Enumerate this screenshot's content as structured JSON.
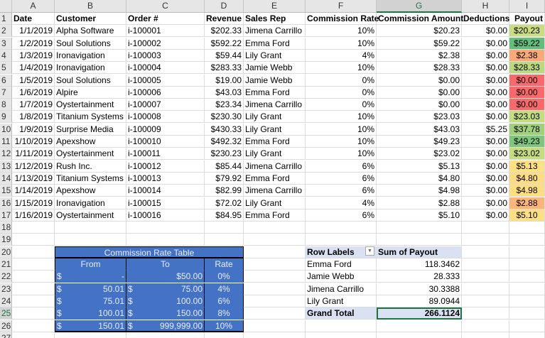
{
  "columns": [
    "A",
    "B",
    "C",
    "D",
    "E",
    "F",
    "G",
    "H",
    "I"
  ],
  "selected_column": "G",
  "selected_row": 25,
  "headers": [
    "Date",
    "Customer",
    "Order #",
    "Revenue",
    "Sales Rep",
    "Commission Rate",
    "Commission Amount",
    "Deductions",
    "Payout"
  ],
  "rows": [
    [
      "1/1/2019",
      "Alpha Software",
      "i-100001",
      "$202.33",
      "Jimena Carrillo",
      "10%",
      "$20.23",
      "$0.00",
      "$20.23"
    ],
    [
      "1/2/2019",
      "Soul Solutions",
      "i-100002",
      "$592.22",
      "Emma Ford",
      "10%",
      "$59.22",
      "$0.00",
      "$59.22"
    ],
    [
      "1/3/2019",
      "Ironavigation",
      "i-100003",
      "$59.44",
      "Lily Grant",
      "4%",
      "$2.38",
      "$0.00",
      "$2.38"
    ],
    [
      "1/4/2019",
      "Ironavigation",
      "i-100004",
      "$283.33",
      "Jamie Webb",
      "10%",
      "$28.33",
      "$0.00",
      "$28.33"
    ],
    [
      "1/5/2019",
      "Soul Solutions",
      "i-100005",
      "$19.00",
      "Jamie Webb",
      "0%",
      "$0.00",
      "$0.00",
      "$0.00"
    ],
    [
      "1/6/2019",
      "Alpire",
      "i-100006",
      "$43.03",
      "Emma Ford",
      "0%",
      "$0.00",
      "$0.00",
      "$0.00"
    ],
    [
      "1/7/2019",
      "Oystertainment",
      "i-100007",
      "$23.34",
      "Jimena Carrillo",
      "0%",
      "$0.00",
      "$0.00",
      "$0.00"
    ],
    [
      "1/8/2019",
      "Titanium Systems",
      "i-100008",
      "$230.30",
      "Lily Grant",
      "10%",
      "$23.03",
      "$0.00",
      "$23.03"
    ],
    [
      "1/9/2019",
      "Surprise Media",
      "i-100009",
      "$430.33",
      "Lily Grant",
      "10%",
      "$43.03",
      "$5.25",
      "$37.78"
    ],
    [
      "1/10/2019",
      "Apexshow",
      "i-100010",
      "$492.32",
      "Emma Ford",
      "10%",
      "$49.23",
      "$0.00",
      "$49.23"
    ],
    [
      "1/11/2019",
      "Oystertainment",
      "i-100011",
      "$230.23",
      "Lily Grant",
      "10%",
      "$23.02",
      "$0.00",
      "$23.02"
    ],
    [
      "1/12/2019",
      "Rush Inc.",
      "i-100012",
      "$85.44",
      "Jimena Carrillo",
      "6%",
      "$5.13",
      "$0.00",
      "$5.13"
    ],
    [
      "1/13/2019",
      "Titanium Systems",
      "i-100013",
      "$79.92",
      "Emma Ford",
      "6%",
      "$4.80",
      "$0.00",
      "$4.80"
    ],
    [
      "1/14/2019",
      "Apexshow",
      "i-100014",
      "$82.99",
      "Jimena Carrillo",
      "6%",
      "$4.98",
      "$0.00",
      "$4.98"
    ],
    [
      "1/15/2019",
      "Ironavigation",
      "i-100015",
      "$72.02",
      "Lily Grant",
      "4%",
      "$2.88",
      "$0.00",
      "$2.88"
    ],
    [
      "1/16/2019",
      "Oystertainment",
      "i-100016",
      "$84.95",
      "Emma Ford",
      "6%",
      "$5.10",
      "$0.00",
      "$5.10"
    ]
  ],
  "payout_colors": [
    "#c9dd80",
    "#63be7b",
    "#fba977",
    "#bcd97f",
    "#f8696b",
    "#f8696b",
    "#f8696b",
    "#c6dc80",
    "#a0d07c",
    "#7fc67d",
    "#c6dc80",
    "#fee182",
    "#fedc81",
    "#fede81",
    "#fbb479",
    "#fee082"
  ],
  "rate_table": {
    "title": "Commission Rate Table",
    "headers": [
      "From",
      "To",
      "Rate"
    ],
    "rows": [
      [
        "$",
        "-",
        "",
        "$50.00",
        "0%"
      ],
      [
        "$",
        "50.01",
        "$",
        "75.00",
        "4%"
      ],
      [
        "$",
        "75.01",
        "$",
        "100.00",
        "6%"
      ],
      [
        "$",
        "100.01",
        "$",
        "150.00",
        "8%"
      ],
      [
        "$",
        "150.01",
        "$",
        "999,999.00",
        "10%"
      ]
    ]
  },
  "pivot": {
    "headers": [
      "Row Labels",
      "Sum of Payout"
    ],
    "rows": [
      [
        "Emma Ford",
        "118.3462"
      ],
      [
        "Jamie Webb",
        "28.333"
      ],
      [
        "Jimena Carrillo",
        "30.3388"
      ],
      [
        "Lily Grant",
        "89.0944"
      ]
    ],
    "total": [
      "Grand Total",
      "266.1124"
    ]
  }
}
